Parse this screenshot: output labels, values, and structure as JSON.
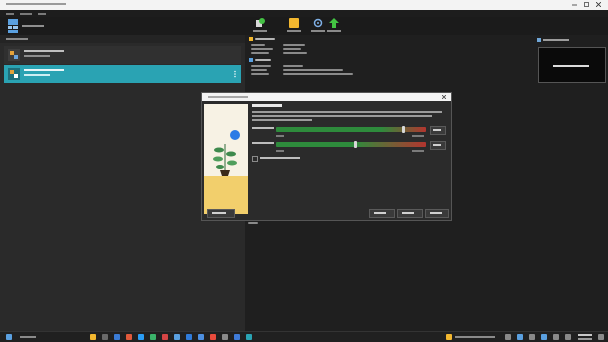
{
  "window": {
    "title": ""
  },
  "menu": {
    "items": [
      "",
      "",
      ""
    ]
  },
  "tools_bar": {
    "label": ""
  },
  "toolbar": {
    "items": [
      {
        "label": "",
        "icon": "new-machine-icon",
        "color": "#44c144"
      },
      {
        "label": "",
        "icon": "add-machine-icon",
        "color": "#f2b72f"
      },
      {
        "label": "",
        "icon": "settings-gear-icon",
        "color": "#7fb0e6"
      },
      {
        "label": "",
        "icon": "start-arrow-icon",
        "color": "#43c443"
      }
    ]
  },
  "vm_list": {
    "header": "",
    "items": [
      {
        "name": "",
        "state": "",
        "selected": false
      },
      {
        "name": "",
        "state": "",
        "selected": true
      }
    ]
  },
  "details": {
    "sections": [
      {
        "heading": "",
        "rows": [
          {
            "label": "",
            "value": ""
          },
          {
            "label": "",
            "value": ""
          },
          {
            "label": "",
            "value": ""
          }
        ]
      },
      {
        "heading": "",
        "rows": [
          {
            "label": "",
            "value": ""
          },
          {
            "label": "",
            "value": ""
          },
          {
            "label": "",
            "value": ""
          }
        ]
      }
    ]
  },
  "preview": {
    "heading": "",
    "screen_text": ""
  },
  "dialog": {
    "title": "",
    "heading": "",
    "description": "",
    "base_memory": {
      "label": "",
      "value_text": "",
      "min_label": "",
      "max_label": "",
      "fill_fraction": 0.7
    },
    "processors": {
      "label": "",
      "value_text": "",
      "min_label": "",
      "max_label": "",
      "fill_fraction": 0.52
    },
    "efi": {
      "label": "",
      "checked": false
    },
    "buttons": {
      "guided": "",
      "back": "",
      "next": "",
      "cancel": ""
    }
  },
  "status_below_dialog": "",
  "taskbar": {
    "search_placeholder": "",
    "tray_text": "",
    "time": "",
    "date": ""
  }
}
